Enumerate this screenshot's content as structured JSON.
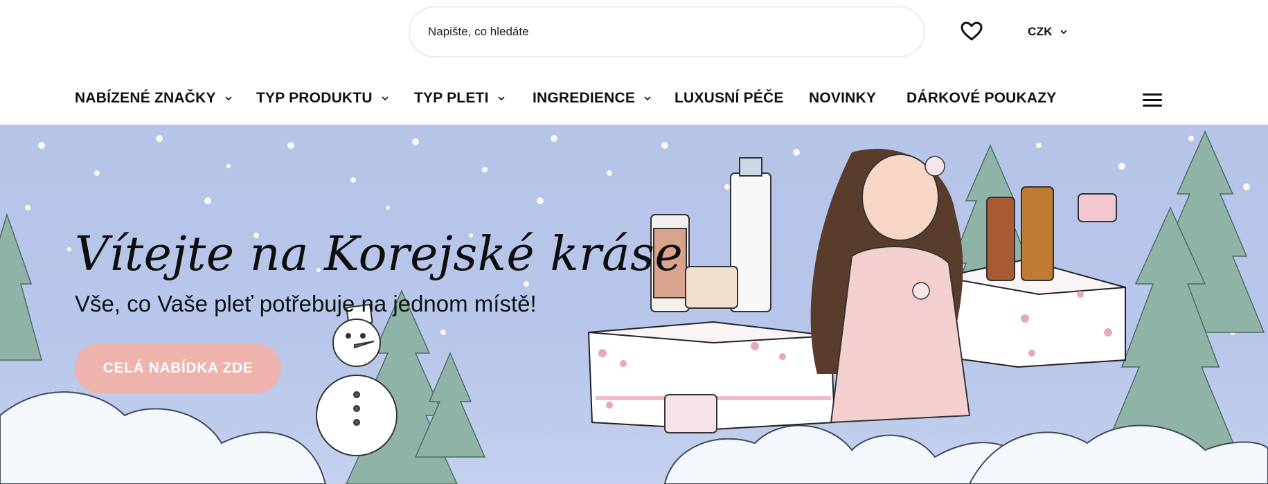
{
  "header": {
    "search": {
      "placeholder": "Napište, co hledáte",
      "value": ""
    },
    "wishlist_icon": "heart-icon",
    "currency": {
      "selected": "CZK"
    }
  },
  "nav": {
    "items": [
      {
        "label": "NABÍZENÉ ZNAČKY",
        "has_dropdown": true
      },
      {
        "label": "TYP PRODUKTU",
        "has_dropdown": true
      },
      {
        "label": "TYP PLETI",
        "has_dropdown": true
      },
      {
        "label": "INGREDIENCE",
        "has_dropdown": true
      },
      {
        "label": "LUXUSNÍ PÉČE",
        "has_dropdown": false
      },
      {
        "label": "NOVINKY",
        "has_dropdown": false
      },
      {
        "label": "DÁRKOVÉ POUKAZY",
        "has_dropdown": false
      }
    ],
    "menu_icon": "hamburger-menu-icon"
  },
  "hero": {
    "title": "Vítejte na Korejské kráse",
    "subtitle": "Vše, co Vaše pleť potřebuje na jednom místě!",
    "cta_label": "CELÁ NABÍDKA ZDE",
    "colors": {
      "sky": "#b6c4e8",
      "cta": "#efb3ad",
      "snow": "#f4f8fc",
      "tree": "#8fb3a6"
    }
  }
}
